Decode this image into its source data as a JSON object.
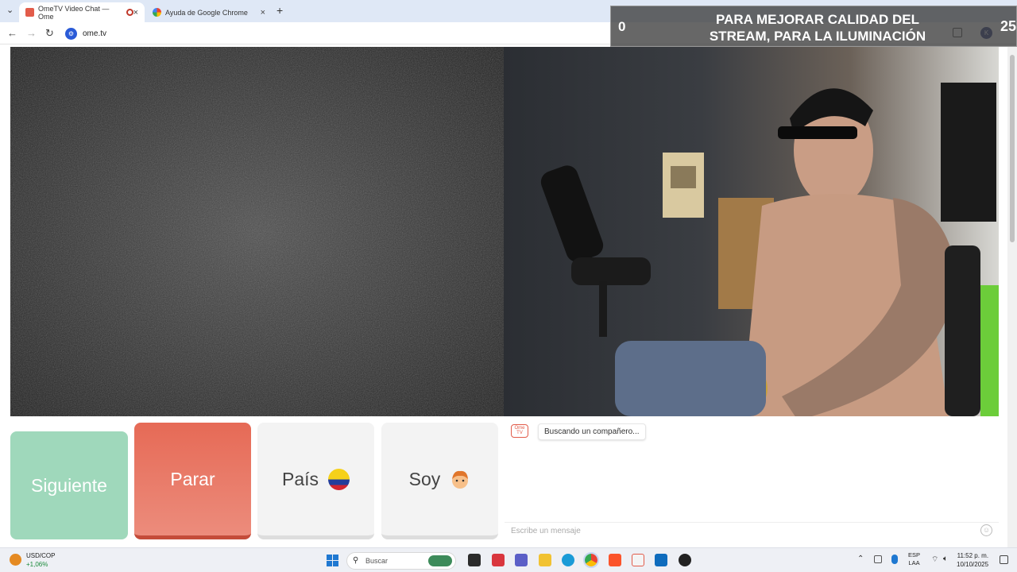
{
  "browser": {
    "tabs": [
      {
        "title": "OmeTV Video Chat — Ome",
        "close": "×"
      },
      {
        "title": "Ayuda de Google Chrome",
        "close": "×"
      }
    ],
    "new_tab": "+",
    "tab_menu": "⌄",
    "url": "ome.tv",
    "back": "←",
    "forward": "→",
    "reload": "↻",
    "profile_initial": "K"
  },
  "overlay": {
    "left_number": "0",
    "message": "PARA MEJORAR CALIDAD DEL STREAM, PARA LA ILUMINACIÓN",
    "right_number": "25"
  },
  "controls": {
    "next_label": "Siguiente",
    "stop_label": "Parar",
    "country_label": "País",
    "gender_label": "Soy"
  },
  "chat": {
    "logo": "Ome TV",
    "status": "Buscando un compañero...",
    "placeholder": "Escribe un mensaje"
  },
  "taskbar": {
    "weather_label": "USD/COP",
    "weather_value": "+1,06%",
    "search_label": "Buscar",
    "lang_line1": "ESP",
    "lang_line2": "LAA",
    "time": "11:52 p. m.",
    "date": "10/10/2025"
  },
  "colors": {
    "next": "#9fd8bb",
    "stop": "#e66a56",
    "neutral_button": "#f3f3f3",
    "tab_bar": "#dfe8f6"
  }
}
